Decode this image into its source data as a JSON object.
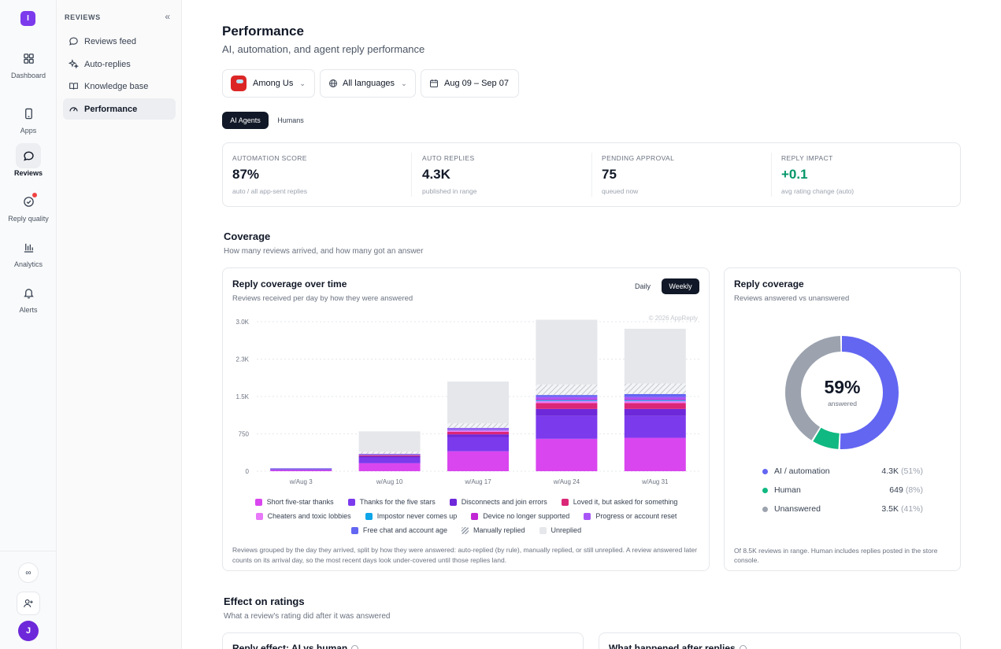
{
  "rail": {
    "logo": "I",
    "items": [
      {
        "label": "Dashboard",
        "icon": "grid-icon"
      },
      {
        "label": "Apps",
        "icon": "phone-icon"
      },
      {
        "label": "Reviews",
        "icon": "chat-icon",
        "active": true
      },
      {
        "label": "Reply quality",
        "icon": "check-circle-icon",
        "badge": true
      },
      {
        "label": "Analytics",
        "icon": "bar-chart-icon"
      },
      {
        "label": "Alerts",
        "icon": "bell-icon"
      }
    ],
    "bottom": {
      "infinity": "∞",
      "avatar": "J"
    }
  },
  "nav": {
    "heading": "REVIEWS",
    "items": [
      {
        "label": "Reviews feed",
        "icon": "chat-bubble-icon"
      },
      {
        "label": "Auto-replies",
        "icon": "sparkle-icon"
      },
      {
        "label": "Knowledge base",
        "icon": "book-icon"
      },
      {
        "label": "Performance",
        "icon": "gauge-icon",
        "active": true
      }
    ]
  },
  "page": {
    "title": "Performance",
    "subtitle": "AI, automation, and agent reply performance"
  },
  "filters": {
    "app": "Among Us",
    "language": "All languages",
    "range": "Aug 09 – Sep 07"
  },
  "segments": {
    "ai": "AI Agents",
    "humans": "Humans",
    "active": "AI Agents"
  },
  "stats": [
    {
      "label": "AUTOMATION SCORE",
      "value": "87%",
      "sub": "auto / all app-sent replies"
    },
    {
      "label": "AUTO REPLIES",
      "value": "4.3K",
      "sub": "published in range"
    },
    {
      "label": "PENDING APPROVAL",
      "value": "75",
      "sub": "queued now"
    },
    {
      "label": "REPLY IMPACT",
      "value": "+0.1",
      "sub": "avg rating change (auto)",
      "color": "#059669"
    }
  ],
  "coverage": {
    "title": "Coverage",
    "subtitle": "How many reviews arrived, and how many got an answer"
  },
  "reply_chart": {
    "title": "Reply coverage over time",
    "subtitle": "Reviews received per day by how they were answered",
    "toggle_daily": "Daily",
    "toggle_weekly": "Weekly",
    "watermark": "© 2026 AppReply",
    "footnote": "Reviews grouped by the day they arrived, split by how they were answered: auto-replied (by rule), manually replied, or still unreplied. A review answered later counts on its arrival day, so the most recent days look under-covered until those replies land."
  },
  "chart_data": {
    "type": "bar",
    "stacked": true,
    "categories": [
      "w/Aug 3",
      "w/Aug 10",
      "w/Aug 17",
      "w/Aug 24",
      "w/Aug 31"
    ],
    "ylim": [
      0,
      3000
    ],
    "yticks": [
      "0",
      "750",
      "1.5K",
      "2.3K",
      "3.0K"
    ],
    "series": [
      {
        "name": "Short five-star thanks",
        "color": "#d946ef",
        "values": [
          20,
          160,
          400,
          650,
          670
        ]
      },
      {
        "name": "Thanks for the five stars",
        "color": "#7c3aed",
        "values": [
          15,
          110,
          280,
          460,
          440
        ]
      },
      {
        "name": "Disconnects and join errors",
        "color": "#6d28d9",
        "values": [
          8,
          30,
          60,
          140,
          140
        ]
      },
      {
        "name": "Loved it, but asked for something",
        "color": "#db2777",
        "values": [
          5,
          20,
          50,
          120,
          120
        ]
      },
      {
        "name": "Cheaters and toxic lobbies",
        "color": "#e879f9",
        "values": [
          2,
          8,
          30,
          40,
          40
        ]
      },
      {
        "name": "Impostor never comes up",
        "color": "#0ea5e9",
        "values": [
          2,
          5,
          10,
          20,
          20
        ]
      },
      {
        "name": "Device no longer supported",
        "color": "#c026d3",
        "values": [
          2,
          5,
          10,
          20,
          20
        ]
      },
      {
        "name": "Progress or account reset",
        "color": "#a855f7",
        "values": [
          2,
          8,
          20,
          40,
          40
        ]
      },
      {
        "name": "Free chat and account age",
        "color": "#6366f1",
        "values": [
          2,
          4,
          10,
          40,
          60
        ]
      },
      {
        "name": "Manually replied",
        "color": "hatch",
        "values": [
          0,
          40,
          90,
          210,
          210
        ]
      },
      {
        "name": "Unreplied",
        "color": "#e5e7eb",
        "values": [
          0,
          410,
          840,
          1300,
          1100
        ]
      }
    ]
  },
  "donut": {
    "title": "Reply coverage",
    "subtitle": "Reviews answered vs unanswered",
    "center_value": "59%",
    "center_label": "answered",
    "segments": [
      {
        "label": "AI / automation",
        "value": "4.3K",
        "pct": "(51%)",
        "fraction": 0.51,
        "color": "#6366f1"
      },
      {
        "label": "Human",
        "value": "649",
        "pct": "(8%)",
        "fraction": 0.08,
        "color": "#10b981"
      },
      {
        "label": "Unanswered",
        "value": "3.5K",
        "pct": "(41%)",
        "fraction": 0.41,
        "color": "#9ca3af"
      }
    ],
    "footnote": "Of 8.5K reviews in range. Human includes replies posted in the store console."
  },
  "effect": {
    "title": "Effect on ratings",
    "subtitle": "What a review's rating did after it was answered",
    "card1": "Reply effect: AI vs human",
    "card2": "What happened after replies"
  }
}
